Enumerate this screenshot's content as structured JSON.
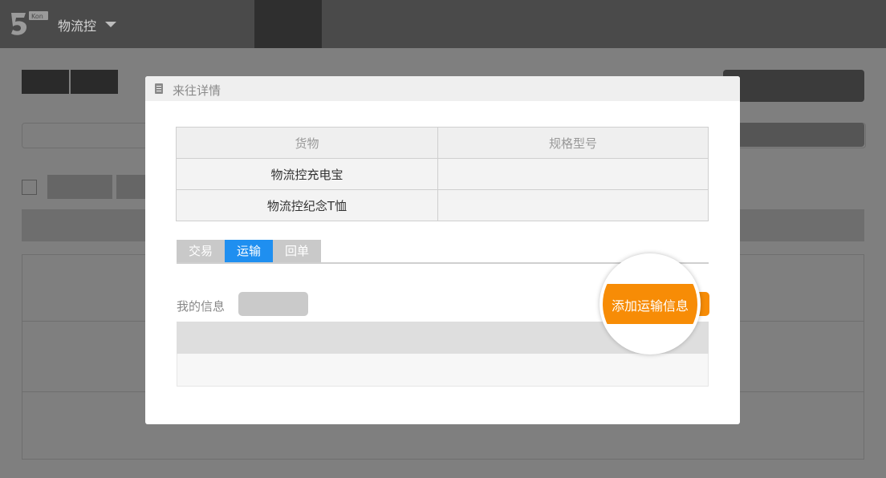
{
  "app": {
    "brand": "物流控",
    "logo_badge": "Kon"
  },
  "modal": {
    "title": "来往详情",
    "goods_table": {
      "headers": [
        "货物",
        "规格型号"
      ],
      "rows": [
        [
          "物流控充电宝",
          ""
        ],
        [
          "物流控纪念T恤",
          ""
        ]
      ]
    },
    "tabs": [
      {
        "label": "交易",
        "active": false
      },
      {
        "label": "运输",
        "active": true
      },
      {
        "label": "回单",
        "active": false
      }
    ],
    "my_info_label": "我的信息",
    "add_transport_button": "添加运输信息"
  },
  "colors": {
    "accent_blue": "#1f8ff0",
    "accent_orange": "#f78c06",
    "topbar": "#4a4a4a"
  },
  "icons": [
    "logo-icon",
    "caret-down-icon",
    "document-icon"
  ]
}
